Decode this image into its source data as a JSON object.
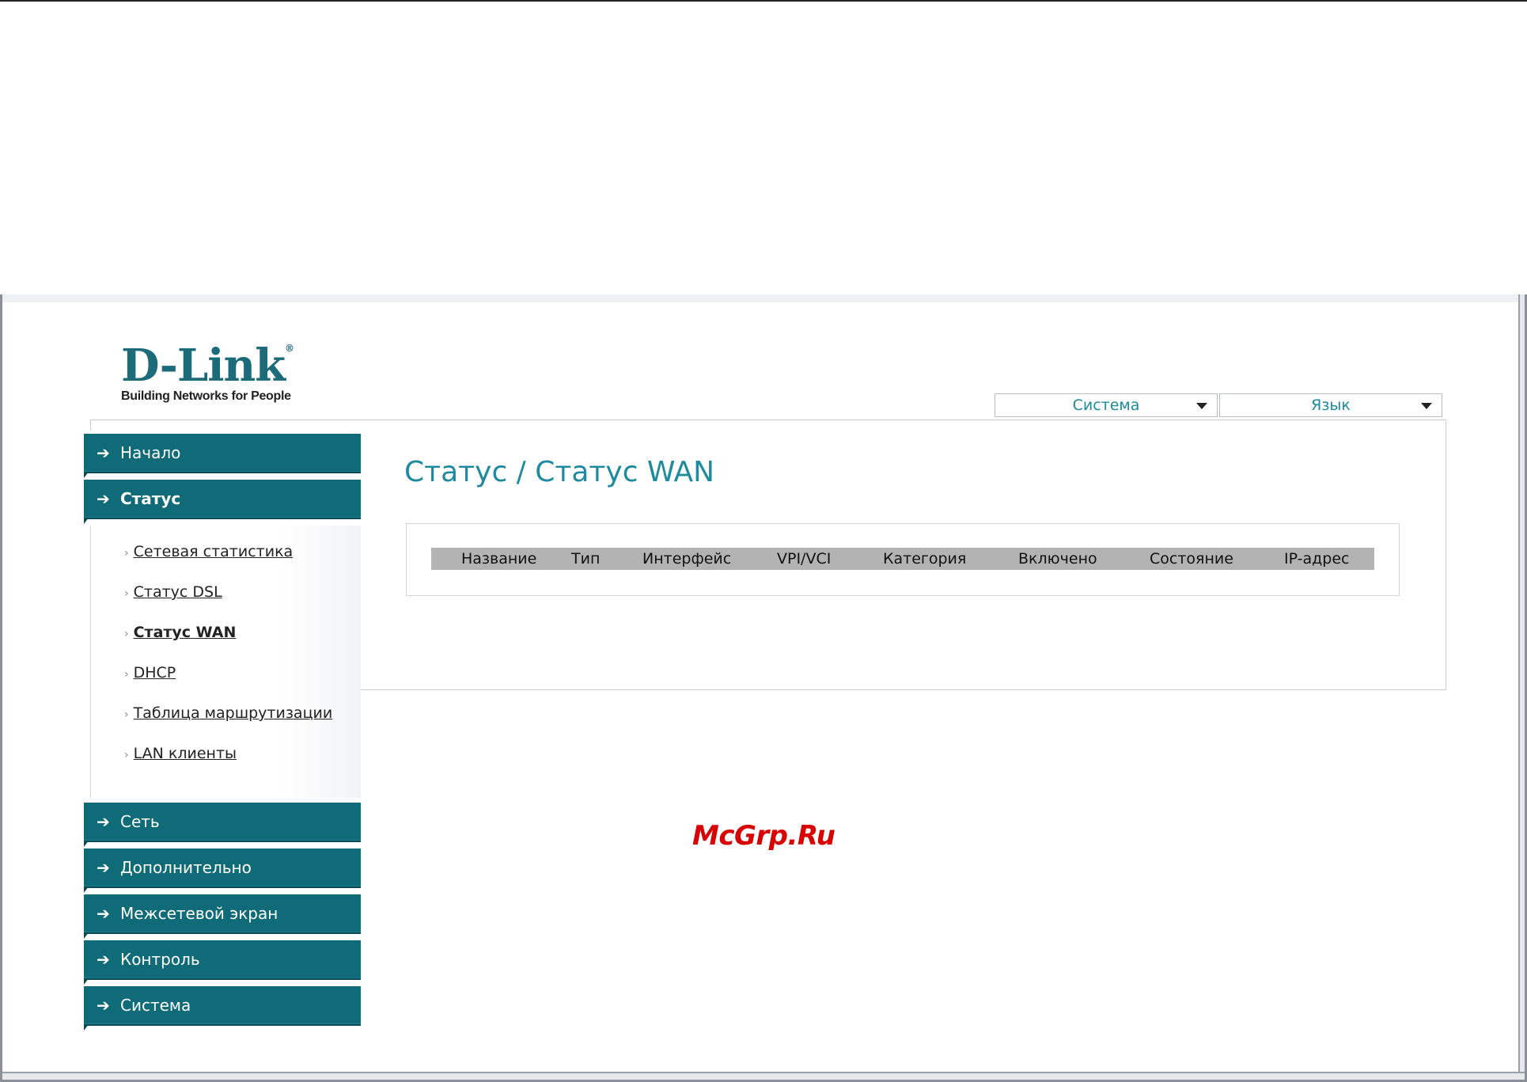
{
  "logo": {
    "main": "D-Link",
    "reg": "®",
    "tagline": "Building Networks for People"
  },
  "header": {
    "system_menu": "Система",
    "language_menu": "Язык"
  },
  "sidebar": {
    "items": [
      {
        "label": "Начало"
      },
      {
        "label": "Статус"
      },
      {
        "label": "Сеть"
      },
      {
        "label": "Дополнительно"
      },
      {
        "label": "Межсетевой экран"
      },
      {
        "label": "Контроль"
      },
      {
        "label": "Система"
      }
    ],
    "status_submenu": [
      {
        "label": "Сетевая статистика"
      },
      {
        "label": "Статус DSL"
      },
      {
        "label": "Статус WAN"
      },
      {
        "label": "DHCP"
      },
      {
        "label": "Таблица маршрутизации"
      },
      {
        "label": "LAN клиенты"
      }
    ]
  },
  "main": {
    "title": "Статус / Статус WAN",
    "table": {
      "columns": [
        "Название",
        "Тип",
        "Интерфейс",
        "VPI/VCI",
        "Категория",
        "Включено",
        "Состояние",
        "IP-адрес"
      ],
      "rows": []
    }
  },
  "watermark": "McGrp.Ru",
  "colors": {
    "accent": "#106b78",
    "title": "#1d8aa0",
    "header_bg": "#b3b3b3"
  }
}
